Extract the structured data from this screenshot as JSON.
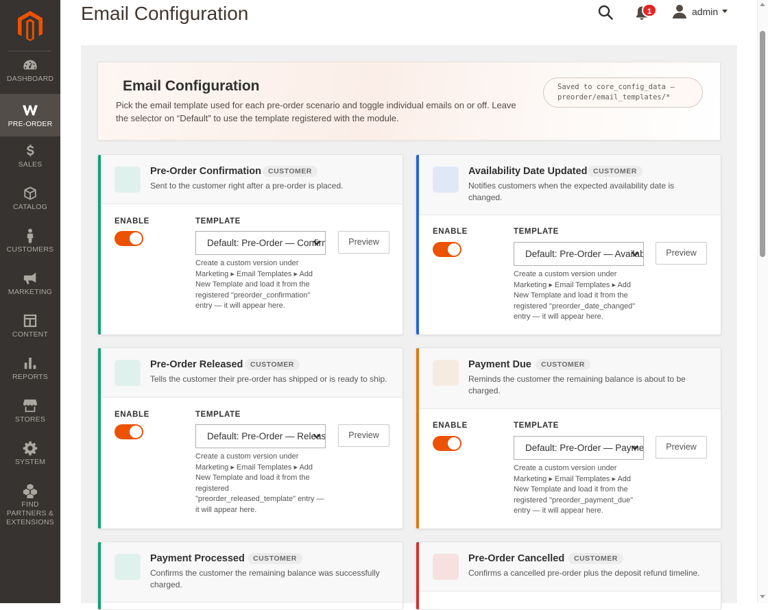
{
  "sidebar": {
    "logo": "magento-logo-icon",
    "items": [
      {
        "label": "DASHBOARD",
        "icon": "dashboard-icon",
        "active": false
      },
      {
        "label": "PRE-ORDER",
        "icon": "preorder-icon",
        "active": true
      },
      {
        "label": "SALES",
        "icon": "dollar-icon",
        "active": false
      },
      {
        "label": "CATALOG",
        "icon": "box-icon",
        "active": false
      },
      {
        "label": "CUSTOMERS",
        "icon": "person-icon",
        "active": false
      },
      {
        "label": "MARKETING",
        "icon": "megaphone-icon",
        "active": false
      },
      {
        "label": "CONTENT",
        "icon": "layout-icon",
        "active": false
      },
      {
        "label": "REPORTS",
        "icon": "bar-chart-icon",
        "active": false
      },
      {
        "label": "STORES",
        "icon": "storefront-icon",
        "active": false
      },
      {
        "label": "SYSTEM",
        "icon": "gear-icon",
        "active": false
      },
      {
        "label": "FIND PARTNERS & EXTENSIONS",
        "icon": "cubes-icon",
        "active": false
      }
    ]
  },
  "header": {
    "title": "Email Configuration",
    "notification_count": "1",
    "user_name": "admin"
  },
  "intro": {
    "title": "Email Configuration",
    "description": "Pick the email template used for each pre-order scenario and toggle individual emails on or off. Leave the selector on “Default” to use the template registered with the module.",
    "saved_note_line1": "Saved to core_config_data —",
    "saved_note_line2": "preorder/email_templates/*"
  },
  "labels": {
    "enable": "ENABLE",
    "template": "TEMPLATE",
    "preview": "Preview",
    "tag": "CUSTOMER"
  },
  "colors": {
    "accent": "#eb5202",
    "green": "#12a07a",
    "blue": "#2563d8",
    "orange": "#dd7a12",
    "red": "#d33030"
  },
  "cards": [
    {
      "title": "Pre-Order Confirmation",
      "tag": "CUSTOMER",
      "description": "Sent to the customer right after a pre-order is placed.",
      "enabled": true,
      "template_value": "Default: Pre-Order — Confirmation",
      "hint": "Create a custom version under Marketing ▸ Email Templates ▸ Add New Template and load it from the registered \"preorder_confirmation\" entry — it will appear here.",
      "accent": "#12a07a",
      "swatch": "#dff1ec"
    },
    {
      "title": "Availability Date Updated",
      "tag": "CUSTOMER",
      "description": "Notifies customers when the expected availability date is changed.",
      "enabled": true,
      "template_value": "Default: Pre-Order — Availability",
      "hint": "Create a custom version under Marketing ▸ Email Templates ▸ Add New Template and load it from the registered \"preorder_date_changed\" entry — it will appear here.",
      "accent": "#2563d8",
      "swatch": "#e0e8f8"
    },
    {
      "title": "Pre-Order Released",
      "tag": "CUSTOMER",
      "description": "Tells the customer their pre-order has shipped or is ready to ship.",
      "enabled": true,
      "template_value": "Default: Pre-Order — Released",
      "hint": "Create a custom version under Marketing ▸ Email Templates ▸ Add New Template and load it from the registered \"preorder_released_template\" entry — it will appear here.",
      "accent": "#12a07a",
      "swatch": "#dff1ec"
    },
    {
      "title": "Payment Due",
      "tag": "CUSTOMER",
      "description": "Reminds the customer the remaining balance is about to be charged.",
      "enabled": true,
      "template_value": "Default: Pre-Order — Payment Due",
      "hint": "Create a custom version under Marketing ▸ Email Templates ▸ Add New Template and load it from the registered \"preorder_payment_due\" entry — it will appear here.",
      "accent": "#dd7a12",
      "swatch": "#f6ebe1"
    },
    {
      "title": "Payment Processed",
      "tag": "CUSTOMER",
      "description": "Confirms the customer the remaining balance was successfully charged.",
      "accent": "#12a07a",
      "swatch": "#dff1ec"
    },
    {
      "title": "Pre-Order Cancelled",
      "tag": "CUSTOMER",
      "description": "Confirms a cancelled pre-order plus the deposit refund timeline.",
      "accent": "#d33030",
      "swatch": "#f6e0e0"
    }
  ]
}
